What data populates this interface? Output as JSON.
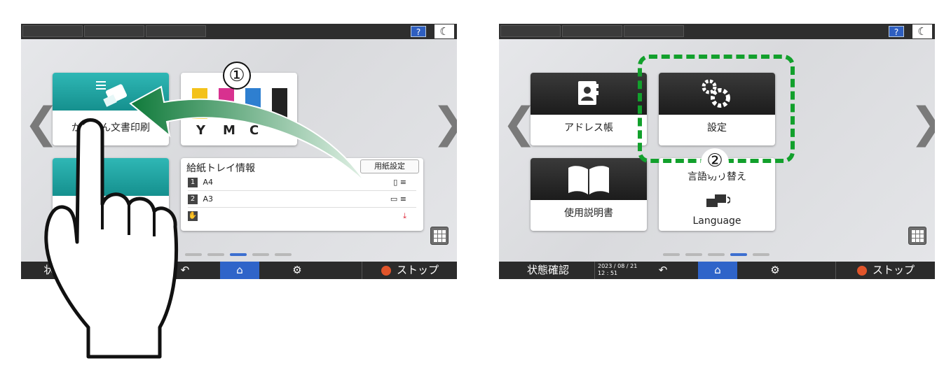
{
  "steps": [
    "①",
    "②"
  ],
  "colors": {
    "accent": "#2f64c9",
    "teal": "#1fa3a1",
    "highlight": "#12a02c",
    "stop": "#e0542a"
  },
  "left_panel": {
    "topbar": {
      "help": "?",
      "moon_icon": "moon-icon"
    },
    "apps": {
      "quick_print_label": "かんたん文書印刷",
      "toner_letters": [
        "Y",
        "M",
        "C"
      ],
      "second_app_label": "コ"
    },
    "tray": {
      "title": "給紙トレイ情報",
      "paper_settings_button": "用紙設定",
      "rows": [
        {
          "num": "1",
          "size": "A4"
        },
        {
          "num": "2",
          "size": "A3"
        }
      ]
    },
    "bottombar": {
      "status": "状",
      "stop": "ストップ"
    }
  },
  "right_panel": {
    "topbar": {
      "help": "?",
      "moon_icon": "moon-icon"
    },
    "apps": {
      "address_book": "アドレス帳",
      "settings": "設定",
      "manual": "使用説明書",
      "language_switch": "言語切り替え",
      "language": "Language"
    },
    "bottombar": {
      "status": "状態確認",
      "date": "2023 / 08 / 21",
      "time": "12 : 51",
      "stop": "ストップ"
    }
  }
}
